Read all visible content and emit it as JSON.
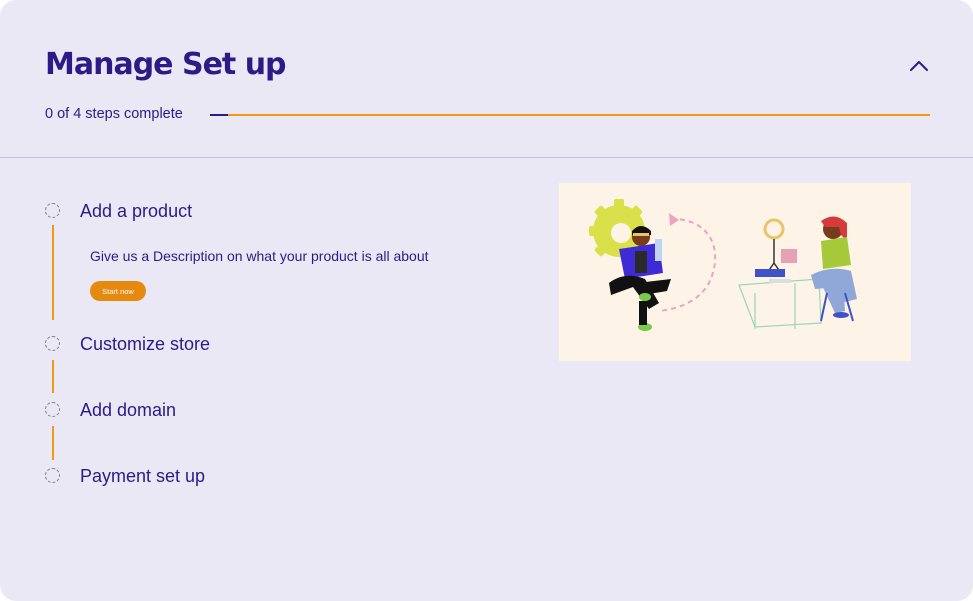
{
  "header": {
    "title": "Manage Set up",
    "collapse_icon": "chevron-up-icon"
  },
  "progress": {
    "text": "0 of 4 steps complete",
    "completed": 0,
    "total": 4
  },
  "steps": [
    {
      "label": "Add a product",
      "expanded": true,
      "description": "Give us a Description on what your product is all about",
      "button_label": "Start now"
    },
    {
      "label": "Customize store"
    },
    {
      "label": "Add domain"
    },
    {
      "label": "Payment set up"
    }
  ],
  "colors": {
    "background": "#eae8f5",
    "primary": "#2e1a87",
    "accent": "#f09a14",
    "button": "#e58a0f",
    "illustration_bg": "#fdf3e6"
  },
  "illustration": {
    "name": "creators-illustration"
  }
}
